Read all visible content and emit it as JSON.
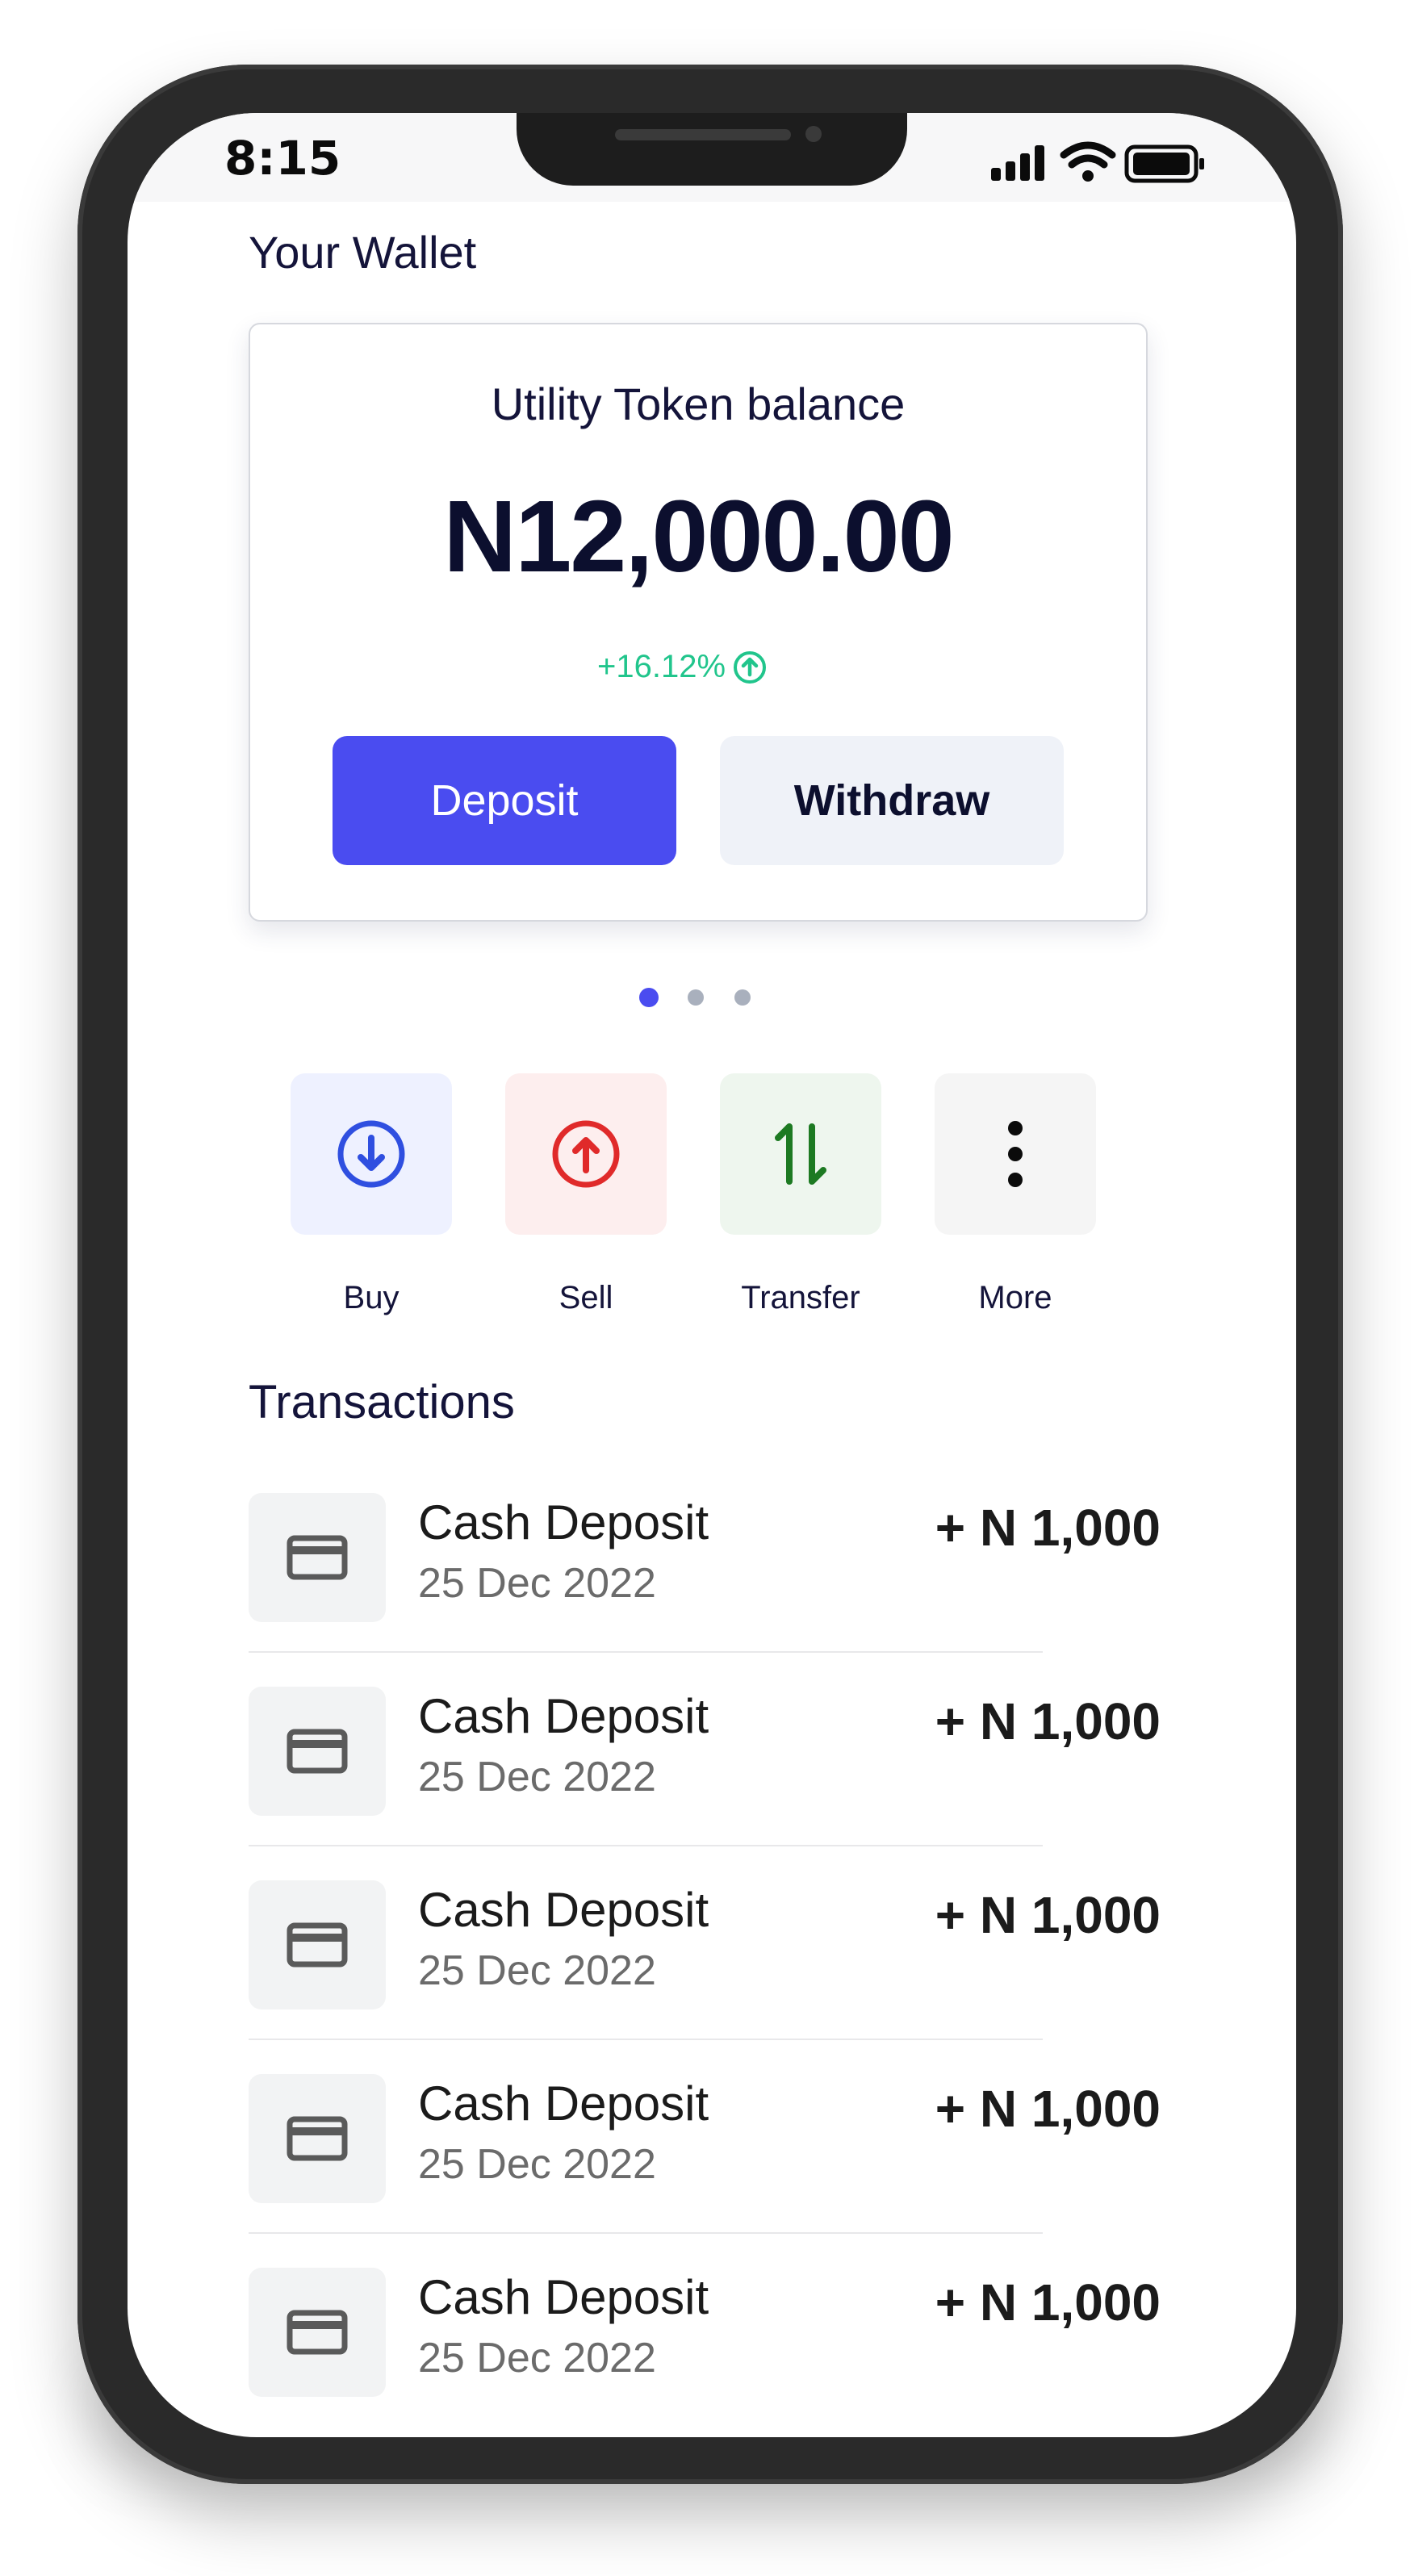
{
  "status_bar": {
    "time": "8:15"
  },
  "wallet": {
    "title": "Your Wallet",
    "card": {
      "label": "Utility Token balance",
      "amount": "N12,000.00",
      "change": "+16.12%",
      "deposit_label": "Deposit",
      "withdraw_label": "Withdraw"
    },
    "pager": {
      "pages": 3,
      "active_index": 0
    }
  },
  "actions": [
    {
      "label": "Buy",
      "icon": "arrow-down-circle-icon",
      "color": "#2f4fe0"
    },
    {
      "label": "Sell",
      "icon": "arrow-up-circle-icon",
      "color": "#e02a2a"
    },
    {
      "label": "Transfer",
      "icon": "transfer-arrows-icon",
      "color": "#1d7a22"
    },
    {
      "label": "More",
      "icon": "more-vertical-icon",
      "color": "#0b0b0b"
    }
  ],
  "transactions": {
    "title": "Transactions",
    "items": [
      {
        "name": "Cash Deposit",
        "date": "25 Dec 2022",
        "amount": "+ N 1,000",
        "icon": "credit-card-icon"
      },
      {
        "name": "Cash Deposit",
        "date": "25 Dec 2022",
        "amount": "+ N 1,000",
        "icon": "credit-card-icon"
      },
      {
        "name": "Cash Deposit",
        "date": "25 Dec 2022",
        "amount": "+ N 1,000",
        "icon": "credit-card-icon"
      },
      {
        "name": "Cash Deposit",
        "date": "25 Dec 2022",
        "amount": "+ N 1,000",
        "icon": "credit-card-icon"
      },
      {
        "name": "Cash Deposit",
        "date": "25 Dec 2022",
        "amount": "+ N 1,000",
        "icon": "credit-card-icon"
      }
    ]
  },
  "colors": {
    "accent": "#4a4cf0",
    "positive": "#21c58c",
    "text_primary": "#14143a"
  }
}
